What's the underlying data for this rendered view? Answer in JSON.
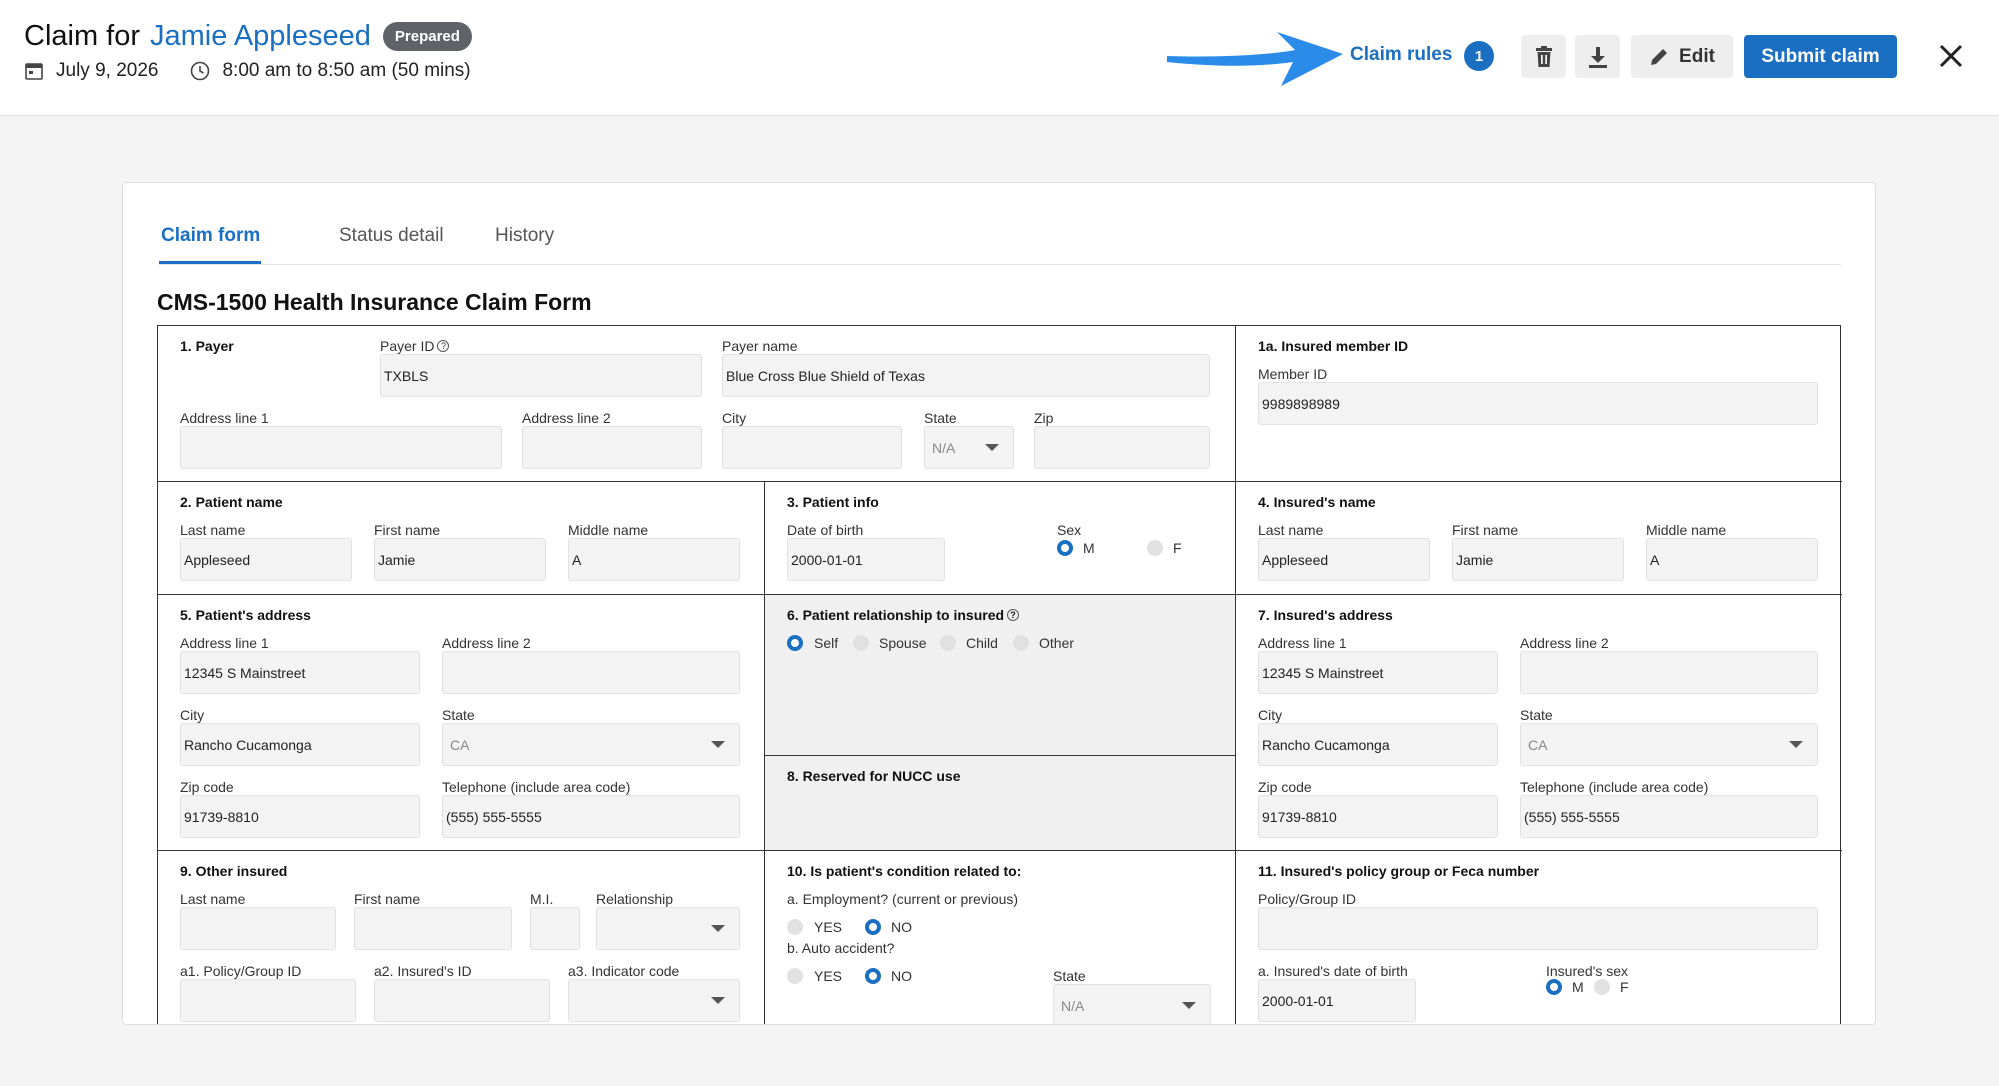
{
  "header": {
    "title_prefix": "Claim for",
    "patient_name": "Jamie Appleseed",
    "status_badge": "Prepared",
    "date": "July 9, 2026",
    "time": "8:00 am to 8:50 am (50 mins)",
    "claim_rules_label": "Claim rules",
    "claim_rules_count": "1",
    "edit_label": "Edit",
    "submit_label": "Submit claim",
    "icons": [
      "calendar-icon",
      "clock-icon",
      "arrow-icon",
      "trash-icon",
      "download-icon",
      "pencil-icon",
      "close-icon"
    ],
    "accent_color": "#1a6fc2"
  },
  "tabs": [
    {
      "label": "Claim form",
      "active": true
    },
    {
      "label": "Status detail",
      "active": false
    },
    {
      "label": "History",
      "active": false
    }
  ],
  "form": {
    "title": "CMS-1500 Health Insurance Claim Form",
    "payer": {
      "title": "1. Payer",
      "payer_id_label": "Payer ID",
      "payer_id": "TXBLS",
      "payer_name_label": "Payer name",
      "payer_name": "Blue Cross Blue Shield of Texas",
      "address1_label": "Address line 1",
      "address2_label": "Address line 2",
      "city_label": "City",
      "state_label": "State",
      "state": "N/A",
      "zip_label": "Zip"
    },
    "insured_member": {
      "title": "1a. Insured member ID",
      "member_id_label": "Member ID",
      "member_id": "9989898989"
    },
    "patient_name": {
      "title": "2. Patient name",
      "last_label": "Last name",
      "last": "Appleseed",
      "first_label": "First name",
      "first": "Jamie",
      "middle_label": "Middle name",
      "middle": "A"
    },
    "patient_info": {
      "title": "3. Patient info",
      "dob_label": "Date of birth",
      "dob": "2000-01-01",
      "sex_label": "Sex",
      "sex_m": "M",
      "sex_f": "F",
      "sex_selected": "M"
    },
    "insured_name": {
      "title": "4. Insured's name",
      "last_label": "Last name",
      "last": "Appleseed",
      "first_label": "First name",
      "first": "Jamie",
      "middle_label": "Middle name",
      "middle": "A"
    },
    "patient_address": {
      "title": "5. Patient's address",
      "address1_label": "Address line 1",
      "address1": "12345 S Mainstreet",
      "address2_label": "Address line 2",
      "city_label": "City",
      "city": "Rancho Cucamonga",
      "state_label": "State",
      "state": "CA",
      "zip_label": "Zip code",
      "zip": "91739-8810",
      "phone_label": "Telephone (include area code)",
      "phone": "(555) 555-5555"
    },
    "relationship": {
      "title": "6. Patient relationship to insured",
      "options": [
        "Self",
        "Spouse",
        "Child",
        "Other"
      ],
      "selected": "Self"
    },
    "insured_address": {
      "title": "7. Insured's address",
      "address1_label": "Address line 1",
      "address1": "12345 S Mainstreet",
      "address2_label": "Address line 2",
      "city_label": "City",
      "city": "Rancho Cucamonga",
      "state_label": "State",
      "state": "CA",
      "zip_label": "Zip code",
      "zip": "91739-8810",
      "phone_label": "Telephone (include area code)",
      "phone": "(555) 555-5555"
    },
    "nucc": {
      "title": "8. Reserved for NUCC use"
    },
    "other_insured": {
      "title": "9. Other insured",
      "last_label": "Last name",
      "first_label": "First name",
      "mi_label": "M.I.",
      "relationship_label": "Relationship",
      "policy_label": "a1. Policy/Group ID",
      "insured_id_label": "a2. Insured's ID",
      "indicator_label": "a3. Indicator code"
    },
    "condition": {
      "title": "10. Is patient's condition related to:",
      "employment_label": "a. Employment? (current or previous)",
      "auto_label": "b. Auto accident?",
      "yes": "YES",
      "no": "NO",
      "employment_selected": "NO",
      "auto_selected": "NO",
      "state_label": "State",
      "state": "N/A"
    },
    "policy_group": {
      "title": "11. Insured's policy group or Feca number",
      "policy_label": "Policy/Group ID",
      "dob_label": "a. Insured's date of birth",
      "dob": "2000-01-01",
      "sex_label": "Insured's sex",
      "sex_m": "M",
      "sex_f": "F",
      "sex_selected": "M"
    }
  }
}
